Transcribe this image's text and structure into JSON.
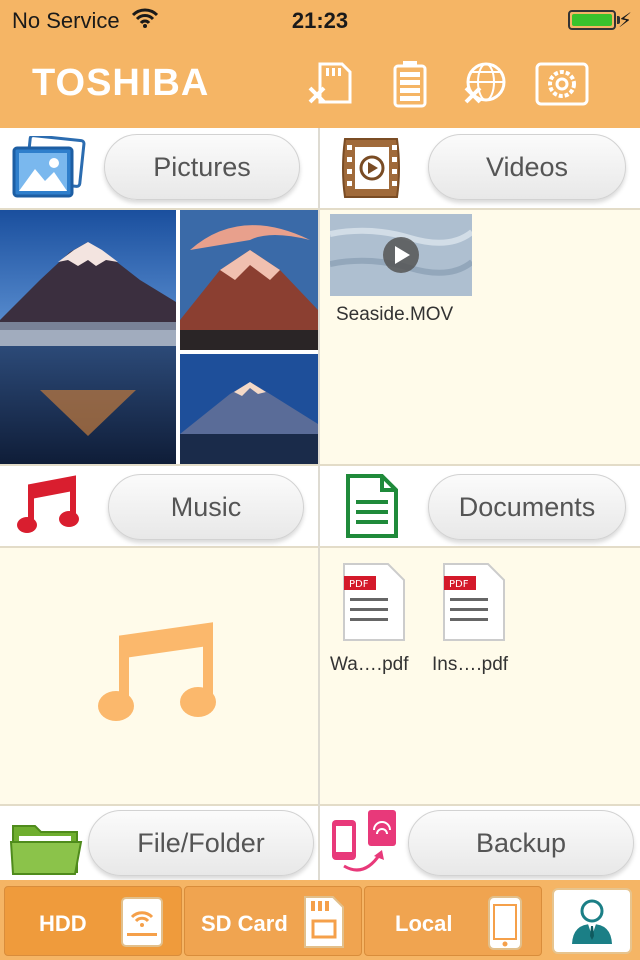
{
  "status_bar": {
    "carrier": "No Service",
    "time": "21:23",
    "battery_level": 1.0
  },
  "header": {
    "brand": "TOSHIBA",
    "buttons": [
      "sd-card-disconnect-icon",
      "battery-icon",
      "network-disconnect-icon",
      "settings-icon"
    ]
  },
  "categories": {
    "pictures": {
      "label": "Pictures"
    },
    "videos": {
      "label": "Videos",
      "files": [
        {
          "name": "Seaside.MOV"
        }
      ]
    },
    "music": {
      "label": "Music"
    },
    "documents": {
      "label": "Documents",
      "files": [
        {
          "name": "Wa….pdf",
          "badge": "PDF"
        },
        {
          "name": "Ins….pdf",
          "badge": "PDF"
        }
      ]
    },
    "file_folder": {
      "label": "File/Folder"
    },
    "backup": {
      "label": "Backup"
    }
  },
  "tabs": [
    {
      "label": "HDD",
      "active": true
    },
    {
      "label": "SD Card",
      "active": false
    },
    {
      "label": "Local",
      "active": false
    }
  ],
  "colors": {
    "brand": "#f5b565",
    "accent": "#ef9b3c",
    "music_icon": "#d91e2f",
    "documents_icon": "#1f8a3a"
  }
}
